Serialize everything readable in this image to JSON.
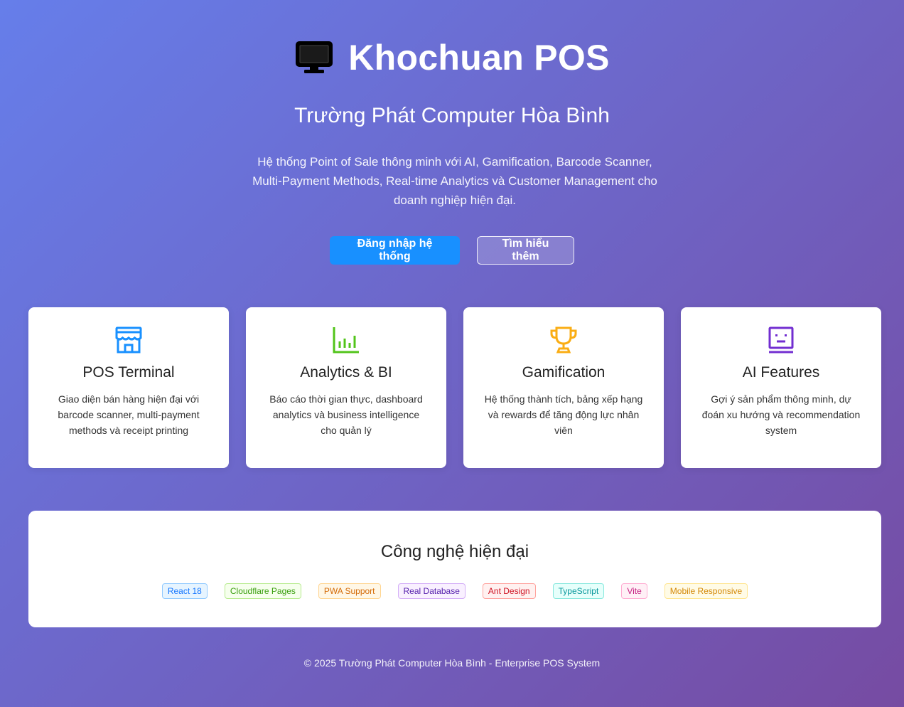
{
  "header": {
    "title": "Khochuan POS",
    "subtitle": "Trường Phát Computer Hòa Bình",
    "description": "Hệ thống Point of Sale thông minh với AI, Gamification, Barcode Scanner, Multi-Payment Methods, Real-time Analytics và Customer Management cho doanh nghiệp hiện đại."
  },
  "buttons": {
    "login_label": "Đăng nhập hệ thống",
    "learn_more_label": "Tìm hiểu thêm"
  },
  "features": [
    {
      "icon": "shop-icon",
      "color": "#1890ff",
      "title": "POS Terminal",
      "desc": "Giao diện bán hàng hiện đại với barcode scanner, multi-payment methods và receipt printing"
    },
    {
      "icon": "bar-chart-icon",
      "color": "#52c41a",
      "title": "Analytics & BI",
      "desc": "Báo cáo thời gian thực, dashboard analytics và business intelligence cho quản lý"
    },
    {
      "icon": "trophy-icon",
      "color": "#faad14",
      "title": "Gamification",
      "desc": "Hệ thống thành tích, bảng xếp hạng và rewards để tăng động lực nhân viên"
    },
    {
      "icon": "robot-icon",
      "color": "#722ed1",
      "title": "AI Features",
      "desc": "Gợi ý sản phẩm thông minh, dự đoán xu hướng và recommendation system"
    }
  ],
  "tech": {
    "title": "Công nghệ hiện đại",
    "tags": [
      {
        "label": "React 18",
        "color": "#1677ff",
        "bg": "#e6f4ff",
        "border": "#91caff"
      },
      {
        "label": "Cloudflare Pages",
        "color": "#389e0d",
        "bg": "#f6ffed",
        "border": "#b7eb8f"
      },
      {
        "label": "PWA Support",
        "color": "#d46b08",
        "bg": "#fff7e6",
        "border": "#ffd591"
      },
      {
        "label": "Real Database",
        "color": "#531dab",
        "bg": "#f9f0ff",
        "border": "#d3adf7"
      },
      {
        "label": "Ant Design",
        "color": "#cf1322",
        "bg": "#fff1f0",
        "border": "#ffa39e"
      },
      {
        "label": "TypeScript",
        "color": "#08979c",
        "bg": "#e6fffb",
        "border": "#87e8de"
      },
      {
        "label": "Vite",
        "color": "#c41d7f",
        "bg": "#fff0f6",
        "border": "#ffadd2"
      },
      {
        "label": "Mobile Responsive",
        "color": "#d48806",
        "bg": "#fffbe6",
        "border": "#ffe58f"
      }
    ]
  },
  "footer": {
    "text": "© 2025 Trường Phát Computer Hòa Bình - Enterprise POS System"
  }
}
